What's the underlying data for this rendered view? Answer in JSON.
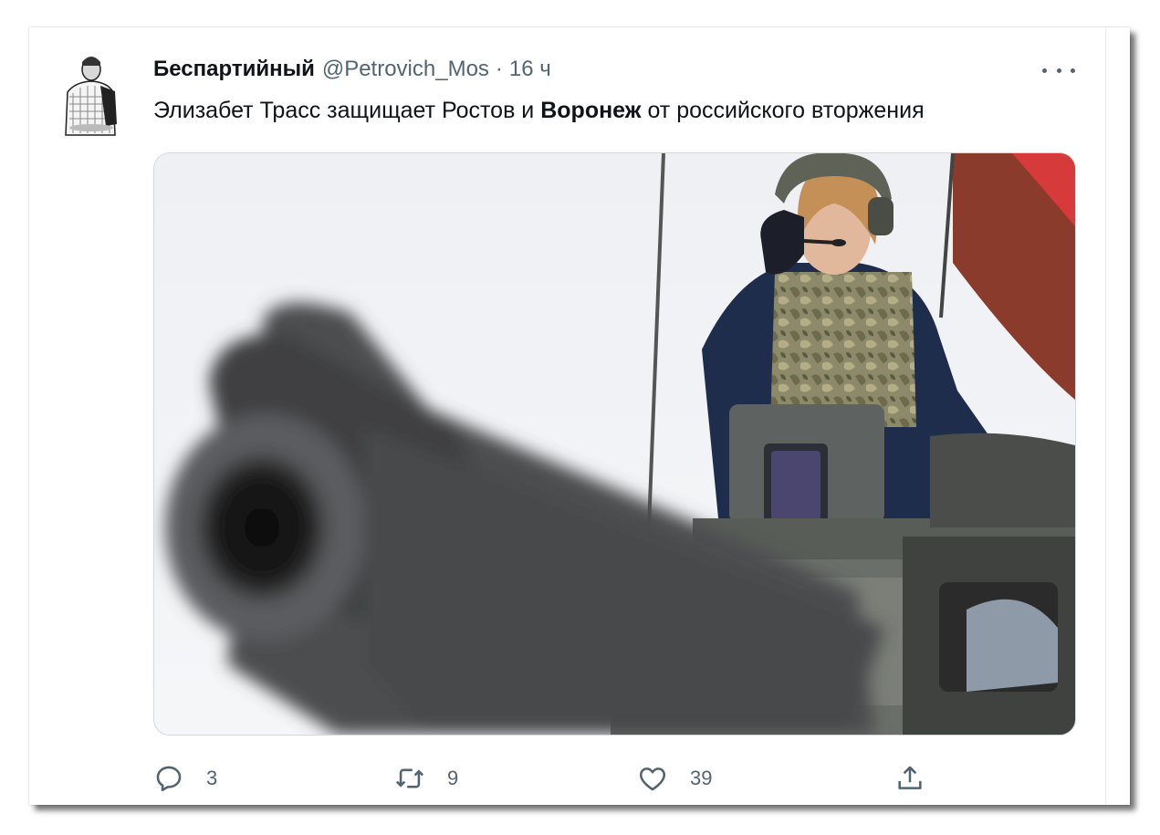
{
  "tweet": {
    "author_name": "Беспартийный",
    "handle": "@Petrovich_Mos",
    "separator": "·",
    "time": "16 ч",
    "text_before": "Элизабет Трасс защищает Ростов и ",
    "text_bold": "Воронеж",
    "text_after": " от российского вторжения"
  },
  "actions": {
    "replies": "3",
    "retweets": "9",
    "likes": "39"
  },
  "colors": {
    "text_primary": "#0f1419",
    "text_secondary": "#536471",
    "border": "#cfd9de"
  },
  "icons": [
    "more-icon",
    "reply-icon",
    "retweet-icon",
    "like-icon",
    "share-icon"
  ]
}
